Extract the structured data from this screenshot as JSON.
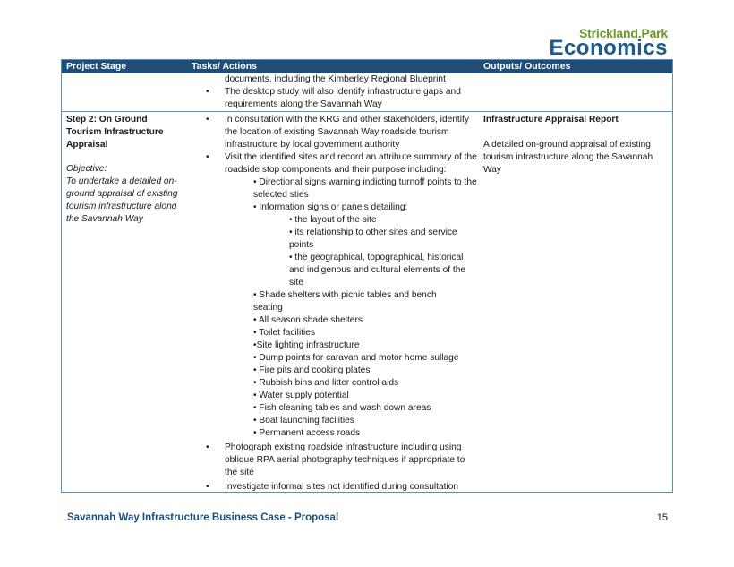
{
  "logo": {
    "top": "Strickland",
    "dot": ".",
    "top2": "Park",
    "main": "Economics"
  },
  "table": {
    "headers": [
      "Project Stage",
      "Tasks/ Actions",
      "Outputs/ Outcomes"
    ],
    "row1": {
      "cont_line": "documents, including the Kimberley Regional Blueprint",
      "bullet": "The desktop study will also identify infrastructure gaps and requirements along the Savannah Way"
    },
    "row2": {
      "stage": "Step 2: On Ground Tourism Infrastructure Appraisal",
      "objective_label": "Objective:",
      "objective_text": "To undertake a detailed on-ground appraisal of existing tourism infrastructure along the Savannah Way",
      "bullet1": "In consultation with the KRG and other stakeholders, identify the location of existing Savannah Way roadside tourism infrastructure by local government authority",
      "bullet2": "Visit the identified sites and record an attribute summary of the roadside stop components and their purpose including:",
      "sub_a": "• Directional signs warning indicting turnoff points to the selected sties",
      "sub_b": "• Information signs or panels detailing:",
      "sub_b1": "• the layout of the site",
      "sub_b2": "• its relationship to other sites and service points",
      "sub_b3": "• the geographical, topographical, historical and indigenous and cultural elements of the site",
      "sub_c": "• Shade shelters with picnic tables and bench seating",
      "sub_d": "• All season shade shelters",
      "sub_e": "• Toilet facilities",
      "sub_f": "•Site lighting infrastructure",
      "sub_g": "• Dump points for caravan and motor home sullage",
      "sub_h": "• Fire pits and cooking plates",
      "sub_i": "• Rubbish bins and litter control aids",
      "sub_j": "• Water supply potential",
      "sub_k": "• Fish cleaning tables and wash down areas",
      "sub_l": "• Boat launching facilities",
      "sub_m": "• Permanent access roads",
      "bullet3": "Photograph existing roadside infrastructure including using oblique RPA aerial photography techniques if appropriate to the site",
      "bullet4": "Investigate informal sites not identified during consultation",
      "output_title": "Infrastructure Appraisal Report",
      "output_text": "A detailed on-ground appraisal of existing tourism infrastructure along the Savannah Way"
    },
    "bullet_char": "•"
  },
  "footer": {
    "title": "Savannah Way Infrastructure Business Case - Proposal",
    "page": "15"
  }
}
